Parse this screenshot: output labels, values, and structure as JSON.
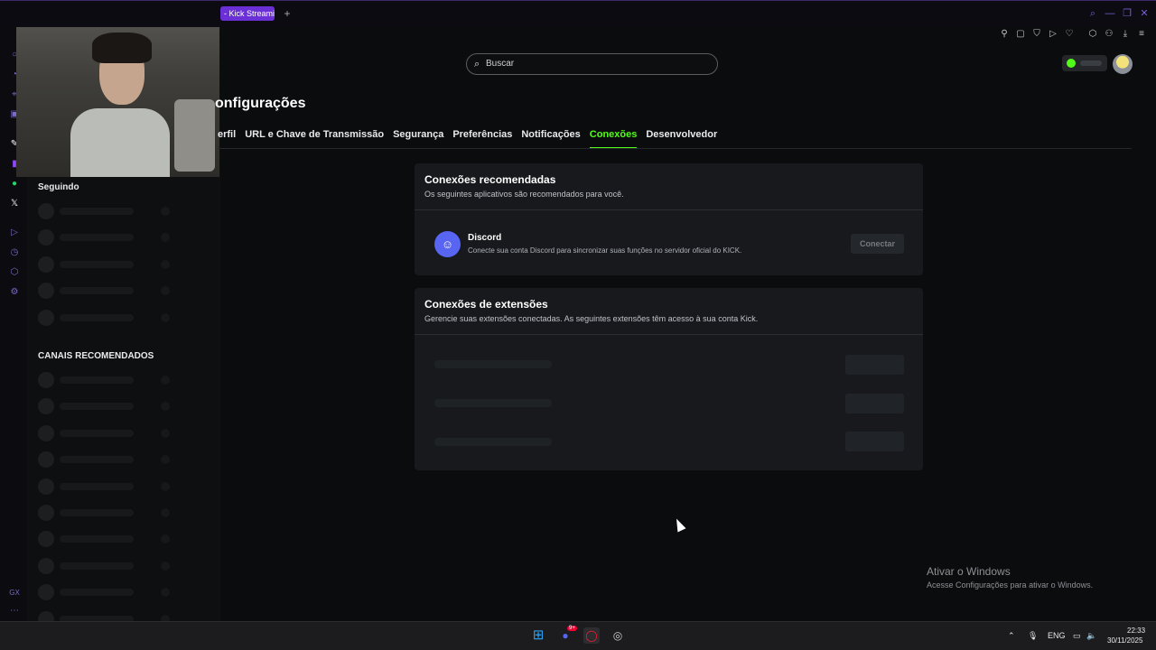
{
  "browser": {
    "tab_title": "- Kick Streami",
    "new_tab": "+"
  },
  "search": {
    "placeholder": "Buscar"
  },
  "settings": {
    "title": "onfigurações",
    "tabs": [
      {
        "label": "erfil"
      },
      {
        "label": "URL e Chave de Transmissão"
      },
      {
        "label": "Segurança"
      },
      {
        "label": "Preferências"
      },
      {
        "label": "Notificações"
      },
      {
        "label": "Conexões",
        "active": true
      },
      {
        "label": "Desenvolvedor"
      }
    ]
  },
  "sidebar": {
    "following_heading": "Seguindo",
    "recommended_heading": "CANAIS RECOMENDADOS"
  },
  "recommended_connections": {
    "title": "Conexões recomendadas",
    "subtitle": "Os seguintes aplicativos são recomendados para você.",
    "items": [
      {
        "name": "Discord",
        "description": "Conecte sua conta Discord para sincronizar suas funções no servidor oficial do KICK.",
        "button": "Conectar",
        "icon": "discord-icon"
      }
    ]
  },
  "extension_connections": {
    "title": "Conexões de extensões",
    "subtitle": "Gerencie suas extensões conectadas. As seguintes extensões têm acesso à sua conta Kick."
  },
  "windows_activation": {
    "title": "Ativar o Windows",
    "subtitle": "Acesse Configurações para ativar o Windows."
  },
  "taskbar": {
    "badge": "9+",
    "language": "ENG",
    "time": "22:33",
    "date": "30/11/2025"
  },
  "colors": {
    "accent": "#53fc18",
    "discord": "#5865f2",
    "browser_accent": "#6b2fd6"
  }
}
